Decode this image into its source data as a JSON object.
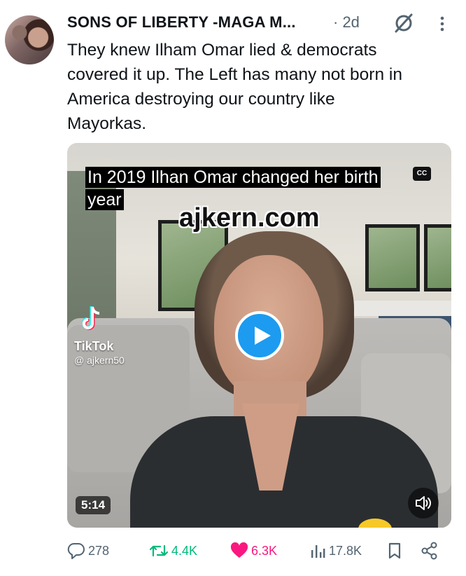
{
  "tweet": {
    "author": "SONS OF LIBERTY -MAGA M...",
    "time": "· 2d",
    "text": "They knew Ilham Omar  lied & democrats\ncovered it up. The Left has many not born in\nAmerica destroying our country like\nMayorkas."
  },
  "video": {
    "caption_line1": "In 2019 Ilhan Omar changed her birth",
    "caption_line2": "year",
    "cc_label": "CC",
    "watermark": "ajkern.com",
    "tiktok_name": "TikTok",
    "tiktok_handle": "@ ajkern50",
    "duration": "5:14"
  },
  "actions": {
    "replies": "278",
    "reposts": "4.4K",
    "likes": "6.3K",
    "views": "17.8K"
  },
  "colors": {
    "like": "#f91880",
    "repost": "#00ba7c",
    "accent": "#1d9bf0",
    "muted": "#536471"
  },
  "icons": [
    "grok-icon",
    "more-icon",
    "play-icon",
    "mute-icon",
    "reply-icon",
    "repost-icon",
    "heart-icon",
    "views-icon",
    "bookmark-icon",
    "share-icon",
    "tiktok-logo"
  ]
}
